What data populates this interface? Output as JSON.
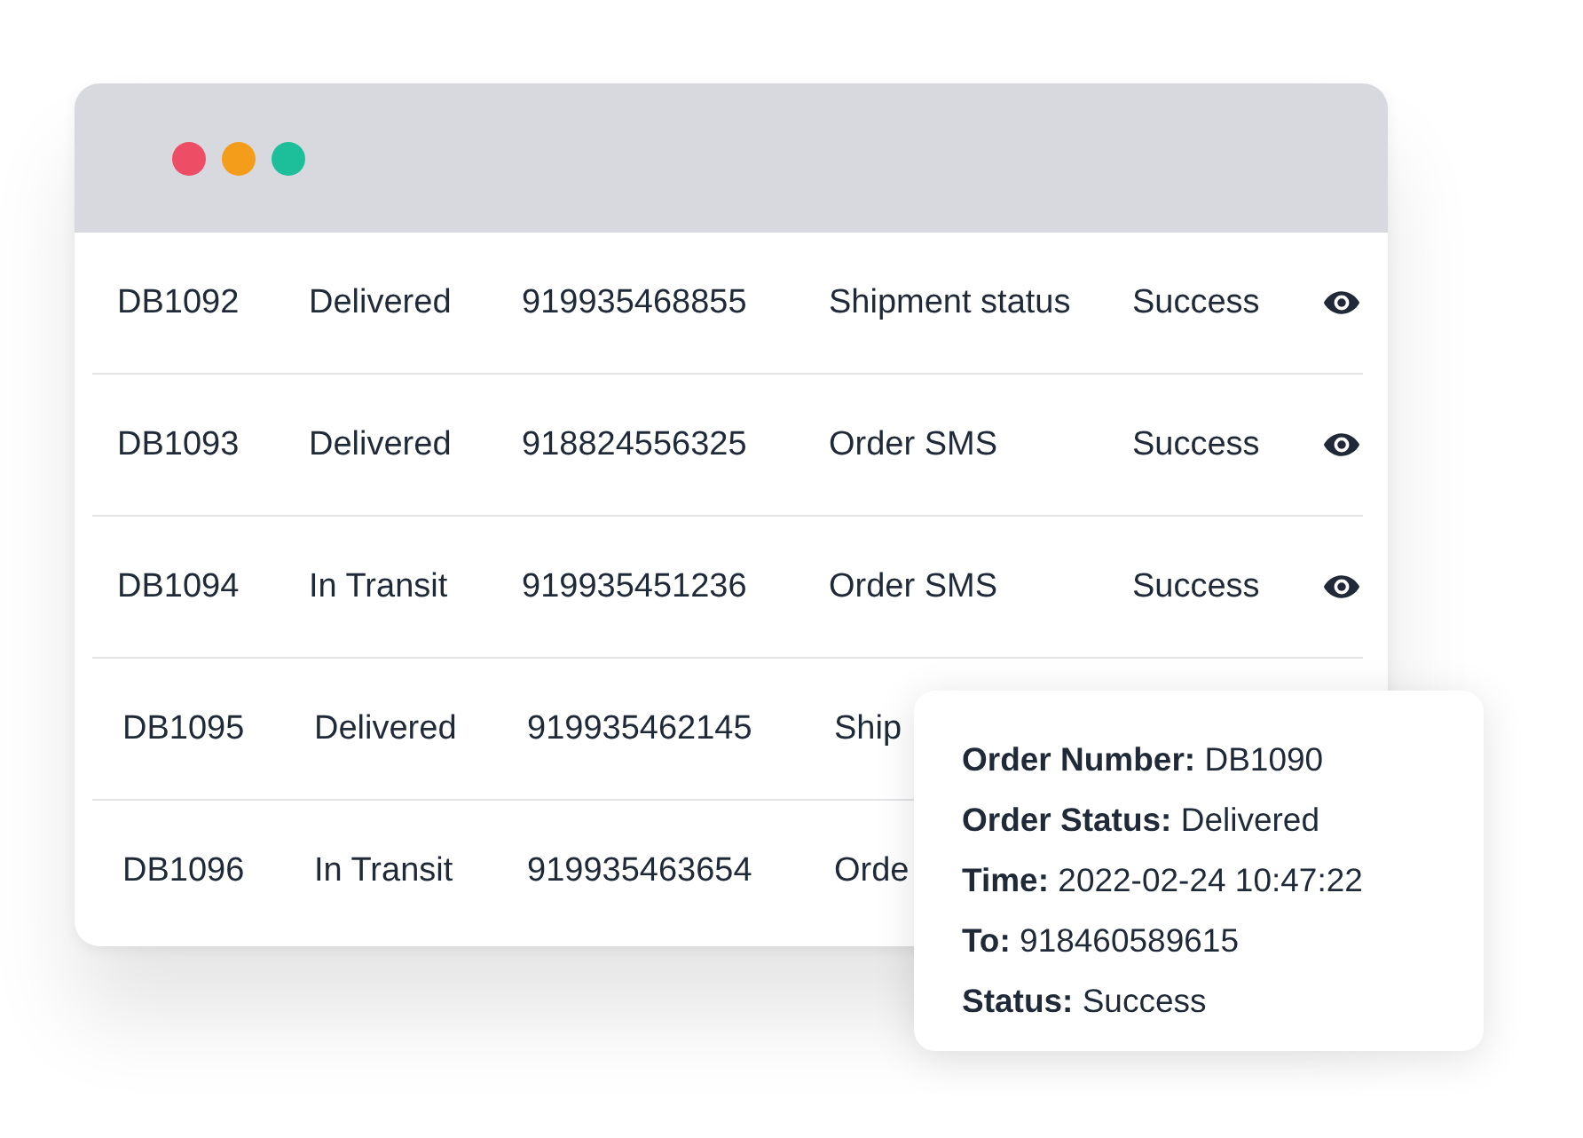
{
  "window": {
    "controls": [
      {
        "color": "#ee4d66"
      },
      {
        "color": "#f49d1a"
      },
      {
        "color": "#1dbf9a"
      }
    ]
  },
  "rows": [
    {
      "cells": [
        "DB1092",
        "Delivered",
        "919935468855",
        "Shipment status",
        "Success"
      ],
      "view": true
    },
    {
      "cells": [
        "DB1093",
        "Delivered",
        "918824556325",
        "Order SMS",
        "Success"
      ],
      "view": true
    },
    {
      "cells": [
        "DB1094",
        "In Transit",
        "919935451236",
        "Order SMS",
        "Success"
      ],
      "view": true
    },
    {
      "cells": [
        "DB1095",
        "Delivered",
        "919935462145",
        "Ship"
      ],
      "view": false
    },
    {
      "cells": [
        "DB1096",
        "In Transit",
        "919935463654",
        "Orde"
      ],
      "view": false
    }
  ],
  "tooltip": {
    "lines": [
      "**Order Number:** DB1090",
      "**Order Status:** Delivered",
      "**Time:** 2022-02-24 10:47:22",
      "**To:** 918460589615",
      "**Status:** Success"
    ]
  }
}
